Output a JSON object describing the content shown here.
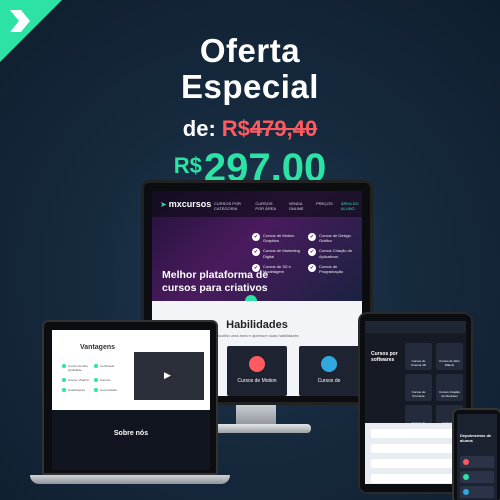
{
  "brand": {
    "accent": "#2de2a5",
    "strike_color": "#ff5a5f",
    "logo_icon": "chevron-arrow-icon"
  },
  "offer": {
    "line1": "Oferta",
    "line2": "Especial",
    "from_label": "de:",
    "old_currency": "R$",
    "old_price": "479,40",
    "new_currency": "R$",
    "new_price": "297,00"
  },
  "monitor_site": {
    "logo": "mxcursos",
    "nav": [
      "CURSOS POR CATEGORIA",
      "CURSOS POR ÁREA",
      "VENDA ONLINE",
      "PREÇOS",
      "ÁREA DO ALUNO"
    ],
    "hero_title": "Melhor plataforma de cursos para criativos",
    "features": [
      "Cursos de Motion Graphics",
      "Cursos de Design Gráfico",
      "Cursos de Marketing Digital",
      "Cursos Criação de Aplicativos",
      "Cursos de 3D e Modelagem",
      "Cursos de Programação"
    ],
    "skills_title": "Habilidades",
    "skills_subtitle": "Escolha uma área e aprimore suas habilidades",
    "skill_cards": [
      "",
      "Cursos de Motion",
      "Cursos de"
    ]
  },
  "laptop_site": {
    "title": "Vantagens",
    "items": [
      "Cursos de Alta Qualidade",
      "Certificado",
      "Acesso Vitalício",
      "Suporte",
      "Atualizações",
      "Comunidade"
    ],
    "about_title": "Sobre nós"
  },
  "tablet_site": {
    "side_title": "Cursos por softwares",
    "cards": [
      "Cursos de Cinema 4D",
      "Cursos de After Effects",
      "Cursos de Premiere",
      "Cursos Criação de Illustrator",
      "Cursos de Illustrator",
      "Cursos de Photoshop"
    ]
  },
  "phone_site": {
    "title": "Depoimentos de alunos"
  }
}
